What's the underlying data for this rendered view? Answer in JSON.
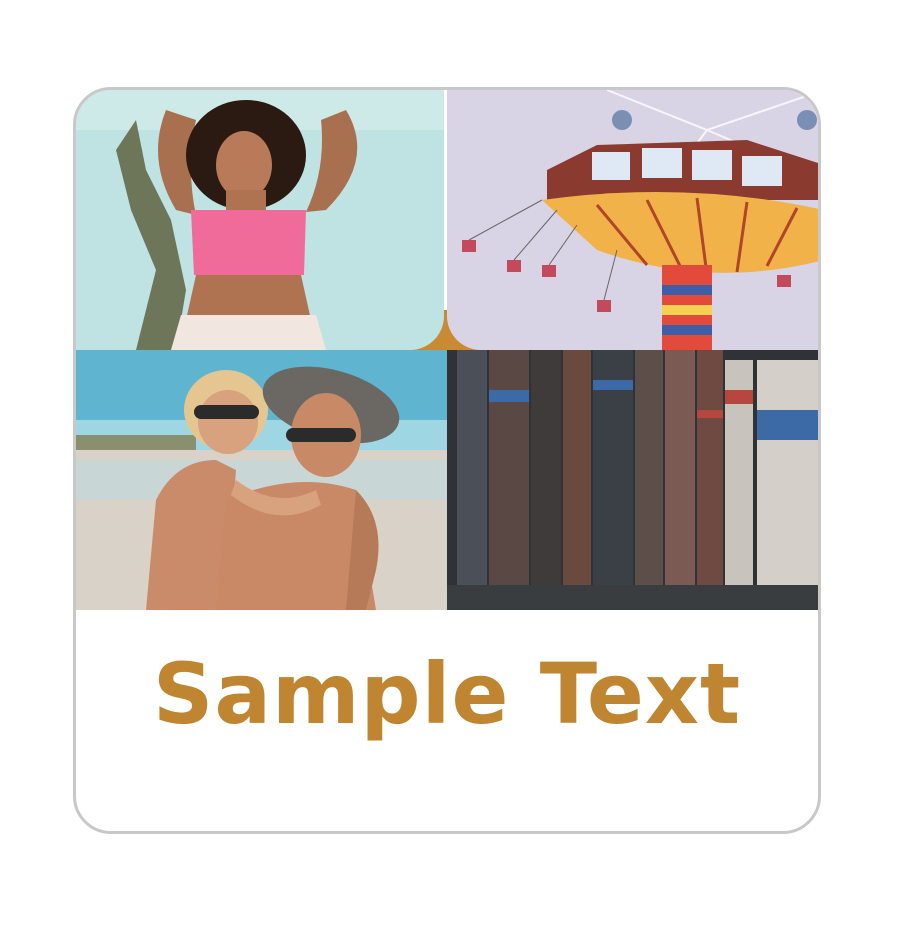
{
  "caption": {
    "text": "Sample Text",
    "color": "#c08530"
  },
  "photos": [
    {
      "subject": "woman-pink-top-photo"
    },
    {
      "subject": "swing-carousel-ride-photo"
    },
    {
      "subject": "couple-beach-photo"
    },
    {
      "subject": "antique-books-shelf-photo"
    }
  ],
  "colors": {
    "border": "#c8c8c8",
    "accent": "#c08530"
  }
}
